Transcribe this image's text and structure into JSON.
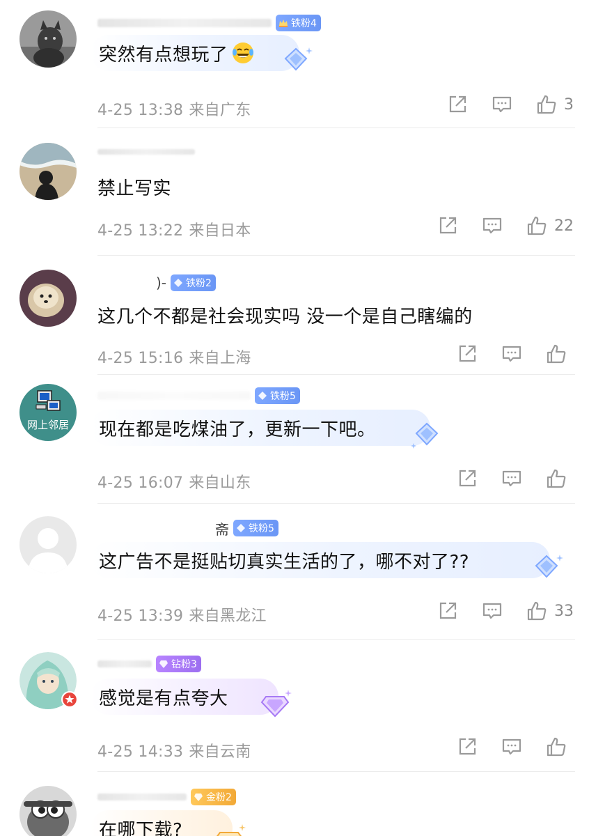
{
  "comments": [
    {
      "name_tail": "",
      "badge": {
        "type": "iron",
        "label": "铁粉4",
        "icon": "crown-icon"
      },
      "text": "突然有点想玩了",
      "emoji": "laughing-tears-emoji",
      "date": "4-25 13:38",
      "location": "来自广东",
      "likes": "3",
      "avatar": "cat-avatar"
    },
    {
      "name_tail": "",
      "badge": null,
      "text": "禁止写实",
      "date": "4-25 13:22",
      "location": "来自日本",
      "likes": "22",
      "avatar": "beach-shadow-avatar"
    },
    {
      "name_tail": ")-",
      "badge": {
        "type": "iron",
        "label": "铁粉2",
        "icon": "gem-icon"
      },
      "text": "这几个不都是社会现实吗 没一个是自己瞎编的",
      "date": "4-25 15:16",
      "location": "来自上海",
      "likes": "",
      "avatar": "dog-avatar"
    },
    {
      "name_tail": "",
      "badge": {
        "type": "iron",
        "label": "铁粉5",
        "icon": "gem-icon"
      },
      "text": "现在都是吃煤油了，更新一下吧。",
      "date": "4-25 16:07",
      "location": "来自山东",
      "likes": "",
      "avatar": "network-avatar",
      "avatar_text": "网上邻居"
    },
    {
      "name_tail": "斋",
      "badge": {
        "type": "iron",
        "label": "铁粉5",
        "icon": "gem-icon"
      },
      "text": "这广告不是挺贴切真实生活的了，哪不对了??",
      "date": "4-25 13:39",
      "location": "来自黑龙江",
      "likes": "33",
      "avatar": "default-avatar"
    },
    {
      "name_tail": "",
      "badge": {
        "type": "diamond",
        "label": "钻粉3",
        "icon": "gem-icon"
      },
      "text": "感觉是有点夸大",
      "date": "4-25 14:33",
      "location": "来自云南",
      "likes": "",
      "avatar": "anime-avatar"
    },
    {
      "name_tail": "",
      "badge": {
        "type": "gold",
        "label": "金粉2",
        "icon": "gem-icon"
      },
      "text": "在哪下载?",
      "date": "",
      "location": "",
      "likes": "",
      "avatar": "cartoon-avatar"
    }
  ],
  "colors": {
    "meta_text": "#9a9a9a",
    "iron_badge": "#7ea7ff",
    "diamond_badge": "#b884ff",
    "gold_badge": "#f2a937"
  }
}
